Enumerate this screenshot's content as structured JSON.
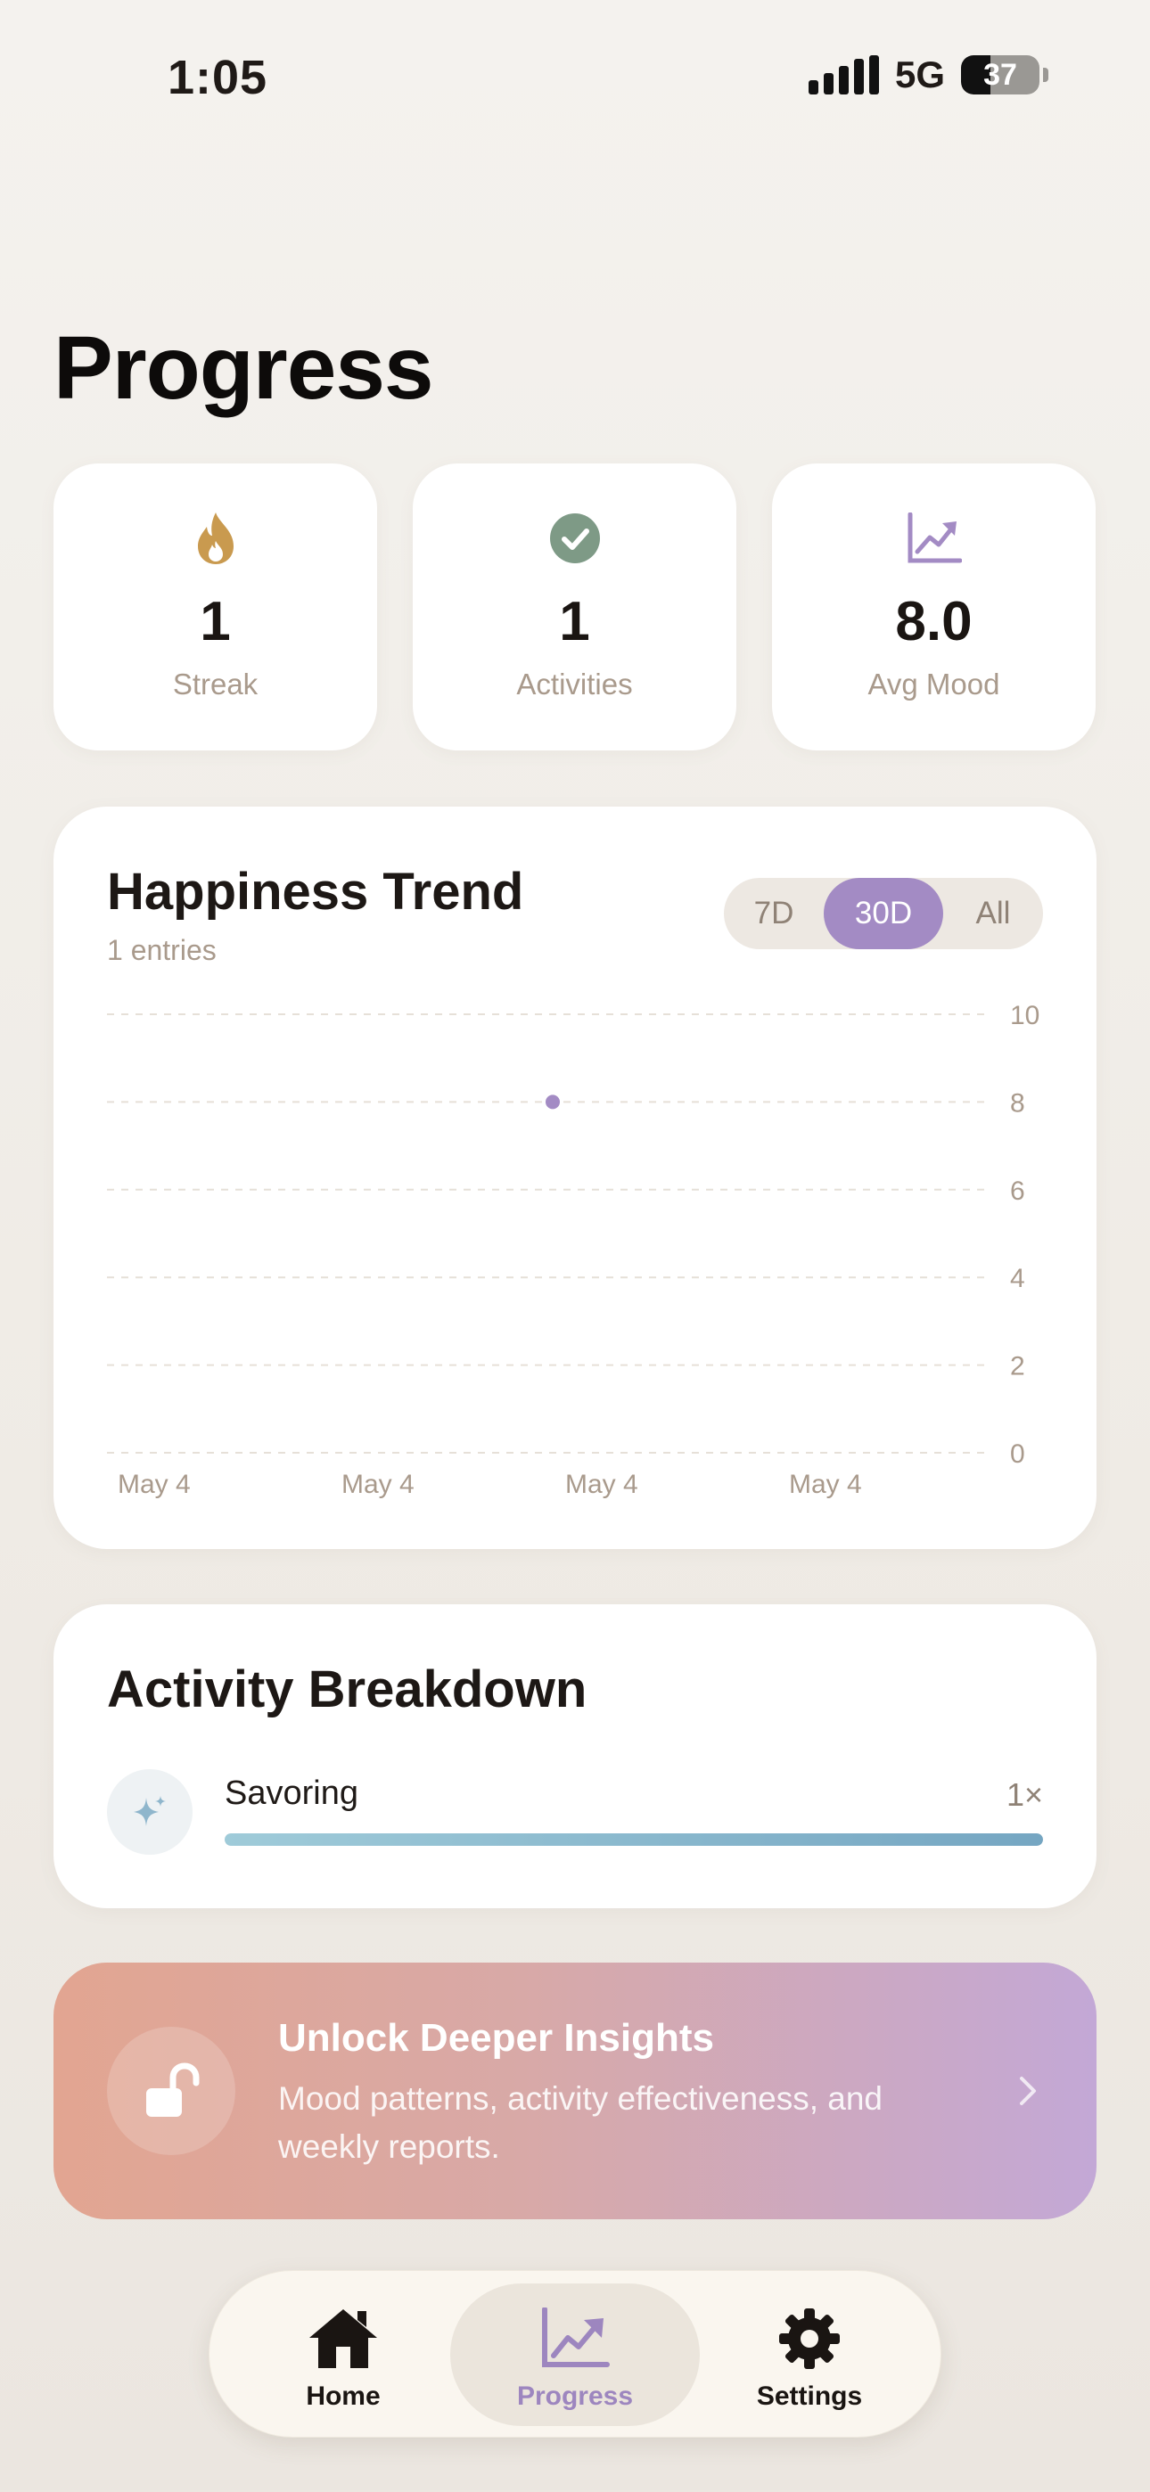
{
  "status_bar": {
    "time": "1:05",
    "network": "5G",
    "battery": "37",
    "battery_level": 0.37
  },
  "page_title": "Progress",
  "stats": [
    {
      "icon": "flame-icon",
      "value": "1",
      "label": "Streak",
      "color": "#c99a4f"
    },
    {
      "icon": "checkmark-circle-icon",
      "value": "1",
      "label": "Activities",
      "color": "#7e9a86"
    },
    {
      "icon": "trend-chart-icon",
      "value": "8.0",
      "label": "Avg Mood",
      "color": "#a38bc4"
    }
  ],
  "trend": {
    "title": "Happiness Trend",
    "subtitle": "1 entries",
    "ranges": [
      "7D",
      "30D",
      "All"
    ],
    "selected_range": "30D"
  },
  "chart_data": {
    "type": "scatter",
    "title": "Happiness Trend",
    "x_tick_labels": [
      "May 4",
      "May 4",
      "May 4",
      "May 4"
    ],
    "y_ticks": [
      10,
      8,
      6,
      4,
      2,
      0
    ],
    "ylim": [
      0,
      10
    ],
    "grid": true,
    "points": [
      {
        "x": "May 4",
        "y": 8
      }
    ],
    "color": "#a38bc4"
  },
  "activity_breakdown": {
    "title": "Activity Breakdown",
    "items": [
      {
        "icon": "sparkles-icon",
        "name": "Savoring",
        "count": "1×",
        "fraction": 1.0
      }
    ]
  },
  "promo": {
    "icon": "unlocked-padlock-icon",
    "title": "Unlock Deeper Insights",
    "description": "Mood patterns, activity effectiveness, and weekly reports."
  },
  "tabbar": {
    "items": [
      {
        "icon": "home-icon",
        "label": "Home",
        "active": false
      },
      {
        "icon": "chart-trend-icon",
        "label": "Progress",
        "active": true
      },
      {
        "icon": "gear-icon",
        "label": "Settings",
        "active": false
      }
    ]
  },
  "colors": {
    "accent": "#a38bc4",
    "background": "#f2efea",
    "muted_text": "#a99a8c"
  }
}
